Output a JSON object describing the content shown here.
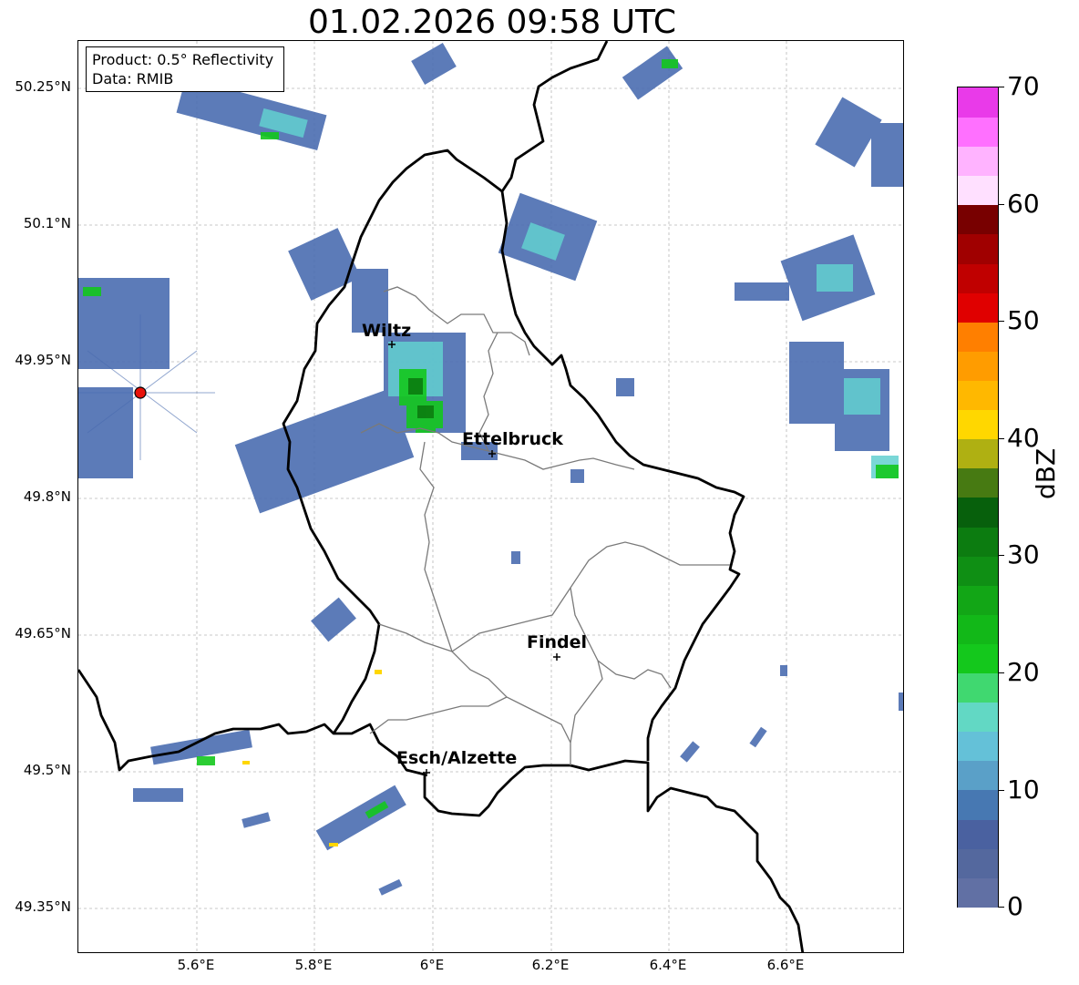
{
  "title": "01.02.2026 09:58 UTC",
  "info": {
    "product_line": "Product: 0.5° Reflectivity",
    "data_line": "Data: RMIB"
  },
  "axes": {
    "lat_labels": [
      "50.25°N",
      "50.1°N",
      "49.95°N",
      "49.8°N",
      "49.65°N",
      "49.5°N",
      "49.35°N"
    ],
    "lon_labels": [
      "5.6°E",
      "5.8°E",
      "6°E",
      "6.2°E",
      "6.4°E",
      "6.6°E"
    ]
  },
  "cities": [
    {
      "name": "Wiltz"
    },
    {
      "name": "Ettelbruck"
    },
    {
      "name": "Findel"
    },
    {
      "name": "Esch/Alzette"
    }
  ],
  "radar_site": {
    "color": "#e8120a"
  },
  "colorbar": {
    "unit": "dBZ",
    "min": 0,
    "max": 70,
    "tick_labels": [
      "0",
      "10",
      "20",
      "30",
      "40",
      "50",
      "60",
      "70"
    ],
    "colors": [
      "#6170a4",
      "#54689e",
      "#4a61a0",
      "#4778b2",
      "#5aa0c8",
      "#64c1d8",
      "#62d8c4",
      "#40d870",
      "#14c81c",
      "#12b818",
      "#12a616",
      "#0f8f14",
      "#0c7c10",
      "#07600c",
      "#477a12",
      "#afb012",
      "#ffd700",
      "#ffb800",
      "#ff9c00",
      "#ff7f00",
      "#e00000",
      "#c00000",
      "#a00000",
      "#780000",
      "#ffe0ff",
      "#ffb3ff",
      "#ff70ff",
      "#e93ae9"
    ]
  }
}
